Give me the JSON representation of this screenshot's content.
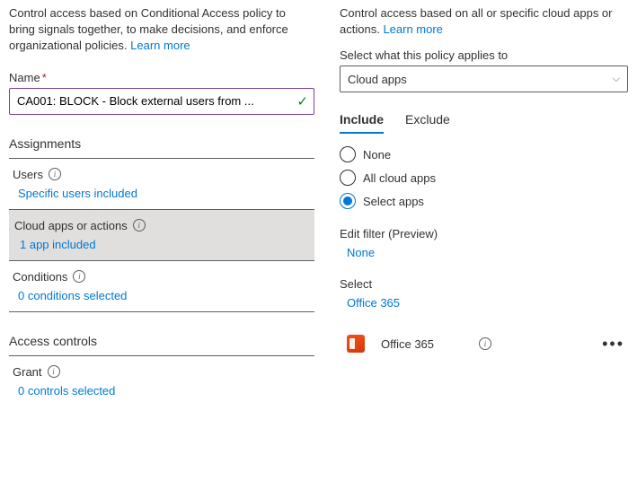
{
  "left": {
    "intro": "Control access based on Conditional Access policy to bring signals together, to make decisions, and enforce organizational policies.",
    "learn_more": "Learn more",
    "name_label": "Name",
    "name_value": "CA001: BLOCK - Block external users from ...",
    "assignments_head": "Assignments",
    "users": {
      "label": "Users",
      "value": "Specific users included"
    },
    "apps": {
      "label": "Cloud apps or actions",
      "value": "1 app included"
    },
    "conditions": {
      "label": "Conditions",
      "value": "0 conditions selected"
    },
    "access_head": "Access controls",
    "grant": {
      "label": "Grant",
      "value": "0 controls selected"
    }
  },
  "right": {
    "intro": "Control access based on all or specific cloud apps or actions.",
    "learn_more": "Learn more",
    "select_label": "Select what this policy applies to",
    "dropdown_value": "Cloud apps",
    "tab_include": "Include",
    "tab_exclude": "Exclude",
    "radio_none": "None",
    "radio_all": "All cloud apps",
    "radio_select": "Select apps",
    "filter_head": "Edit filter (Preview)",
    "filter_value": "None",
    "select_head": "Select",
    "select_value": "Office 365",
    "app_name": "Office 365"
  }
}
